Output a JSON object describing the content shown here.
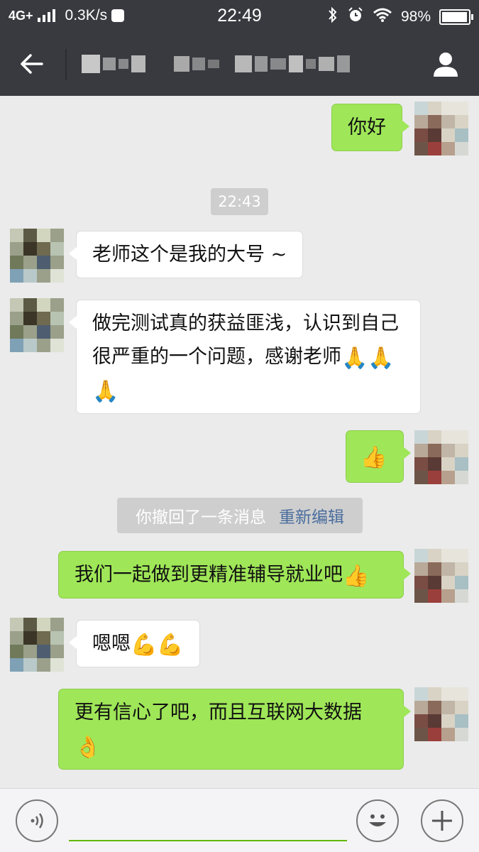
{
  "status_bar": {
    "network": "4G+",
    "speed": "0.3K/s",
    "time": "22:49",
    "battery": "98%"
  },
  "header": {
    "title": "",
    "back_icon": "arrow-left-icon",
    "profile_icon": "person-icon"
  },
  "colors": {
    "header_bg": "#393a3f",
    "chat_bg": "#ebebeb",
    "sent_bubble": "#9fe658",
    "received_bubble": "#ffffff",
    "accent_green": "#62b900"
  },
  "messages": [
    {
      "from": "me",
      "text": "你好"
    },
    {
      "type": "timestamp",
      "text": "22:43"
    },
    {
      "from": "other",
      "text": "老师这个是我的大号 ~"
    },
    {
      "from": "other",
      "text": "做完测试真的获益匪浅，认识到自己很严重的一个问题，感谢老师",
      "emoji": "🙏🙏🙏"
    },
    {
      "from": "me",
      "emoji": "👍"
    },
    {
      "type": "system",
      "text": "你撤回了一条消息",
      "link": "重新编辑"
    },
    {
      "from": "me",
      "text": "我们一起做到更精准辅导就业吧",
      "emoji": "👍"
    },
    {
      "from": "other",
      "text": "嗯嗯",
      "emoji": "💪💪"
    },
    {
      "from": "me",
      "text": "更有信心了吧，而且互联网大数据",
      "emoji": "👌"
    }
  ],
  "input_bar": {
    "voice_icon": "voice-icon",
    "emoji_icon": "smiley-icon",
    "more_icon": "plus-icon",
    "value": ""
  }
}
